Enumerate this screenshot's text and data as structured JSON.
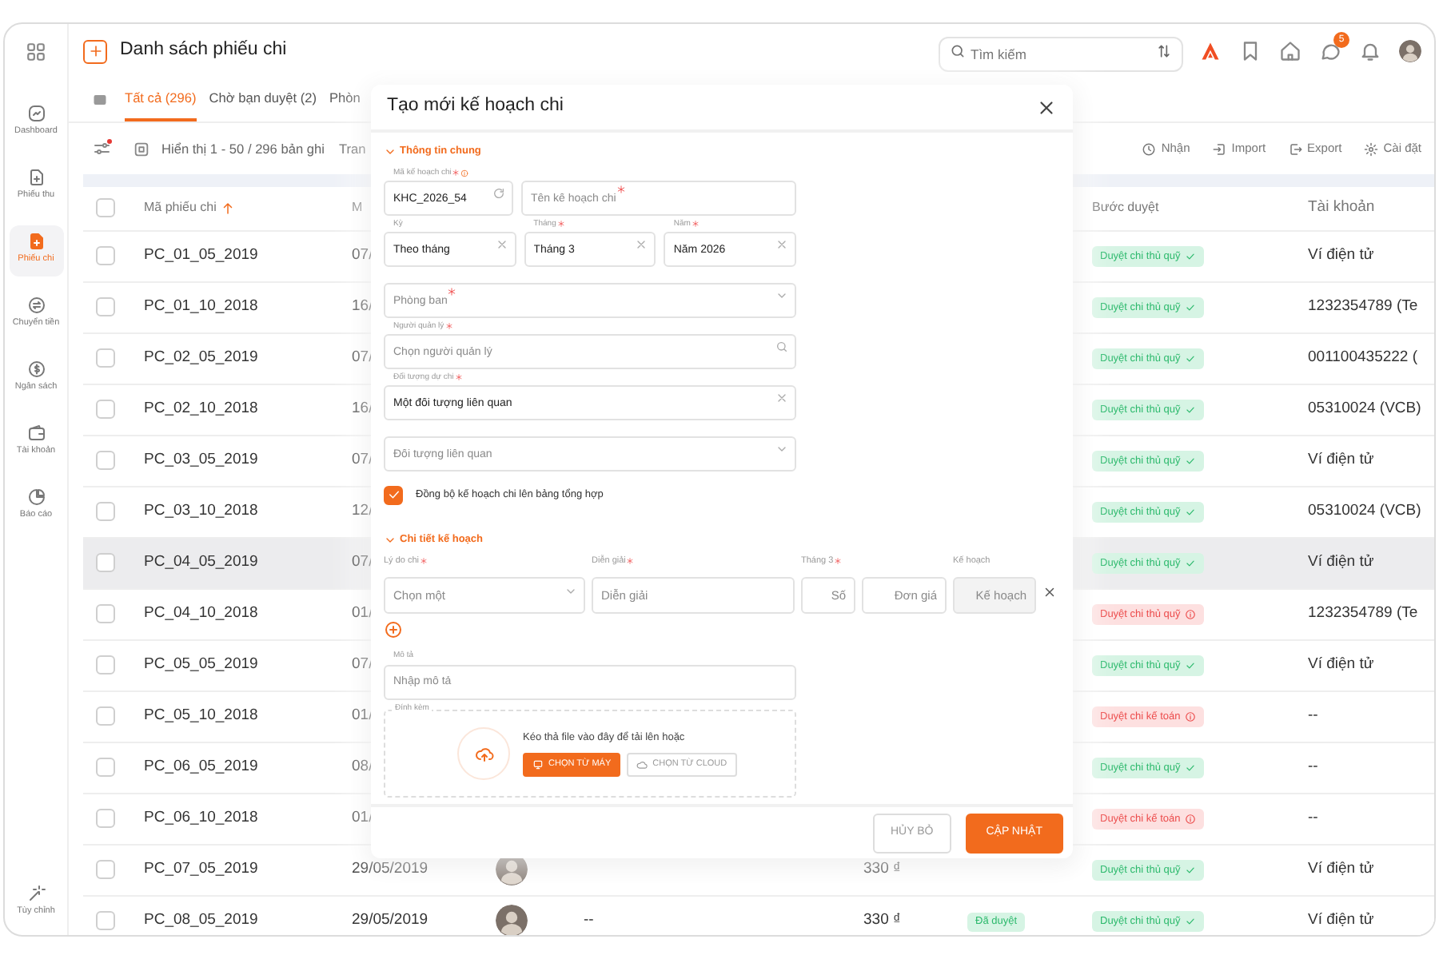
{
  "sidebar": {
    "items": [
      {
        "label": "Dashboard",
        "selected": false
      },
      {
        "label": "Phiếu thu",
        "selected": false
      },
      {
        "label": "Phiếu chi",
        "selected": true
      },
      {
        "label": "Chuyển tiền",
        "selected": false
      },
      {
        "label": "Ngân sách",
        "selected": false
      },
      {
        "label": "Tài khoản",
        "selected": false
      },
      {
        "label": "Báo cáo",
        "selected": false
      }
    ],
    "footer_item": {
      "label": "Tùy chỉnh",
      "selected": false
    }
  },
  "header": {
    "title": "Danh sách phiếu chi",
    "search": {
      "placeholder": "Tìm kiếm"
    },
    "chat_badge": "5"
  },
  "tabs": [
    {
      "label": "Tất cả (296)",
      "selected": true
    },
    {
      "label": "Chờ bạn duyệt (2)",
      "selected": false
    },
    {
      "label": "Phòn",
      "selected": false
    }
  ],
  "toolbar": {
    "filter_active": true,
    "record_info": "Hiển thị 1 - 50 / 296 bản ghi",
    "partial_label": "Tran",
    "actions": [
      {
        "label": "Nhận"
      },
      {
        "label": "Import"
      },
      {
        "label": "Export"
      },
      {
        "label": "Cài đặt"
      }
    ]
  },
  "table": {
    "header_checked": false,
    "columns": [
      {
        "label": "Mã phiếu chi",
        "sorted": true
      },
      {
        "label": "M",
        "sorted": false
      },
      {
        "label": "Bước duyệt",
        "sorted": false
      },
      {
        "label": "Tài khoản",
        "sorted": false
      }
    ],
    "rows": [
      {
        "checked": false,
        "highlighted": false,
        "code": "PC_01_05_2019",
        "date": "07/",
        "step": {
          "label": "Duyệt chi thủ quỹ",
          "approved": true
        },
        "account": "Ví điện tử"
      },
      {
        "checked": false,
        "highlighted": false,
        "code": "PC_01_10_2018",
        "date": "16/",
        "step": {
          "label": "Duyệt chi thủ quỹ",
          "approved": true
        },
        "account": "1232354789 (Te"
      },
      {
        "checked": false,
        "highlighted": false,
        "code": "PC_02_05_2019",
        "date": "07/",
        "step": {
          "label": "Duyệt chi thủ quỹ",
          "approved": true
        },
        "account": "001100435222 ("
      },
      {
        "checked": false,
        "highlighted": false,
        "code": "PC_02_10_2018",
        "date": "16/",
        "step": {
          "label": "Duyệt chi thủ quỹ",
          "approved": true
        },
        "account": "05310024 (VCB)"
      },
      {
        "checked": false,
        "highlighted": false,
        "code": "PC_03_05_2019",
        "date": "07/",
        "step": {
          "label": "Duyệt chi thủ quỹ",
          "approved": true
        },
        "account": "Ví điện tử"
      },
      {
        "checked": false,
        "highlighted": false,
        "code": "PC_03_10_2018",
        "date": "12/",
        "step": {
          "label": "Duyệt chi thủ quỹ",
          "approved": true
        },
        "account": "05310024 (VCB)"
      },
      {
        "checked": false,
        "highlighted": true,
        "code": "PC_04_05_2019",
        "date": "07/",
        "step": {
          "label": "Duyệt chi thủ quỹ",
          "approved": true
        },
        "account": "Ví điện tử"
      },
      {
        "checked": false,
        "highlighted": false,
        "code": "PC_04_10_2018",
        "date": "01/",
        "step": {
          "label": "Duyệt chi thủ quỹ",
          "approved": false
        },
        "account": "1232354789 (Te"
      },
      {
        "checked": false,
        "highlighted": false,
        "code": "PC_05_05_2019",
        "date": "07/",
        "step": {
          "label": "Duyệt chi thủ quỹ",
          "approved": true
        },
        "account": "Ví điện tử"
      },
      {
        "checked": false,
        "highlighted": false,
        "code": "PC_05_10_2018",
        "date": "01/",
        "step": {
          "label": "Duyệt chi kế toán",
          "approved": false
        },
        "account": "--"
      },
      {
        "checked": false,
        "highlighted": false,
        "code": "PC_06_05_2019",
        "date": "08/",
        "step": {
          "label": "Duyệt chi thủ quỹ",
          "approved": true
        },
        "account": "--"
      },
      {
        "checked": false,
        "highlighted": false,
        "code": "PC_06_10_2018",
        "date": "01/",
        "step": {
          "label": "Duyệt chi kế toán",
          "approved": false
        },
        "account": "--"
      },
      {
        "checked": false,
        "highlighted": false,
        "code": "PC_07_05_2019",
        "date": "29/05/2019",
        "avatar": true,
        "amount": "330 ₫",
        "step": {
          "label": "Duyệt chi thủ quỹ",
          "approved": true
        },
        "account": "Ví điện tử"
      },
      {
        "checked": false,
        "highlighted": false,
        "code": "PC_08_05_2019",
        "date": "29/05/2019",
        "avatar": true,
        "column_5": "--",
        "amount": "330 ₫",
        "status": "Đã duyệt",
        "step": {
          "label": "Duyệt chi thủ quỹ",
          "approved": true
        },
        "account": "Ví điện tử"
      }
    ]
  },
  "modal": {
    "title": "Tạo mới kế hoạch chi",
    "general": {
      "title": "Thông tin chung",
      "expanded": true,
      "rows": [
        [
          {
            "kind": "code",
            "label": "Mã kế hoạch chi",
            "required": true,
            "info": true,
            "value": "KHC_2026_54"
          },
          {
            "kind": "text",
            "placeholder": "Tên kế hoạch chi",
            "required": true
          }
        ],
        [
          {
            "kind": "clearable",
            "label": "Kỳ",
            "required": false,
            "value": "Theo tháng"
          },
          {
            "kind": "clearable",
            "label": "Tháng",
            "required": true,
            "value": "Tháng 3"
          },
          {
            "kind": "clearable",
            "label": "Năm",
            "required": true,
            "value": "Năm 2026"
          }
        ],
        [
          {
            "kind": "select",
            "placeholder": "Phòng ban",
            "required": true
          }
        ],
        [
          {
            "kind": "search",
            "label": "Người quản lý",
            "required": true,
            "placeholder": "Chọn người quản lý"
          }
        ],
        [
          {
            "kind": "clearable",
            "label": "Đối tượng dự chi",
            "required": true,
            "value": "Một đối tượng liên quan"
          }
        ],
        [
          {
            "kind": "select",
            "placeholder": "Đối tượng liên quan",
            "required": false
          }
        ]
      ]
    },
    "sync": {
      "label": "Đồng bộ kế hoạch chi lên bảng tổng hợp",
      "checked": true
    },
    "detail": {
      "title": "Chi tiết kế hoạch",
      "expanded": true,
      "labels": [
        {
          "label": "Lý do chi",
          "required": true
        },
        {
          "label": "Diễn giải",
          "required": true
        },
        {
          "label": "Tháng 3",
          "required": true
        },
        {
          "label": "Kế hoạch",
          "required": false
        }
      ],
      "line": [
        {
          "kind": "select",
          "placeholder": "Chọn một"
        },
        {
          "kind": "text",
          "placeholder": "Diễn giải"
        },
        {
          "kind": "number",
          "placeholder": "Số"
        },
        {
          "kind": "number",
          "placeholder": "Đơn giá"
        },
        {
          "kind": "readonly",
          "placeholder": "Kế hoạch"
        }
      ]
    },
    "description": {
      "label": "Mô tả",
      "placeholder": "Nhập mô tả"
    },
    "attachment": {
      "label": "Đính kèm",
      "hint": "Kéo thả file vào đây để tải lên hoặc",
      "buttons": [
        {
          "label": "CHỌN TỪ MÁY",
          "kind": "primary"
        },
        {
          "label": "CHỌN TỪ CLOUD",
          "kind": "secondary"
        }
      ]
    },
    "buttons": [
      {
        "label": "HỦY BỎ",
        "kind": "secondary"
      },
      {
        "label": "CẬP NHẬT",
        "kind": "primary"
      }
    ]
  }
}
